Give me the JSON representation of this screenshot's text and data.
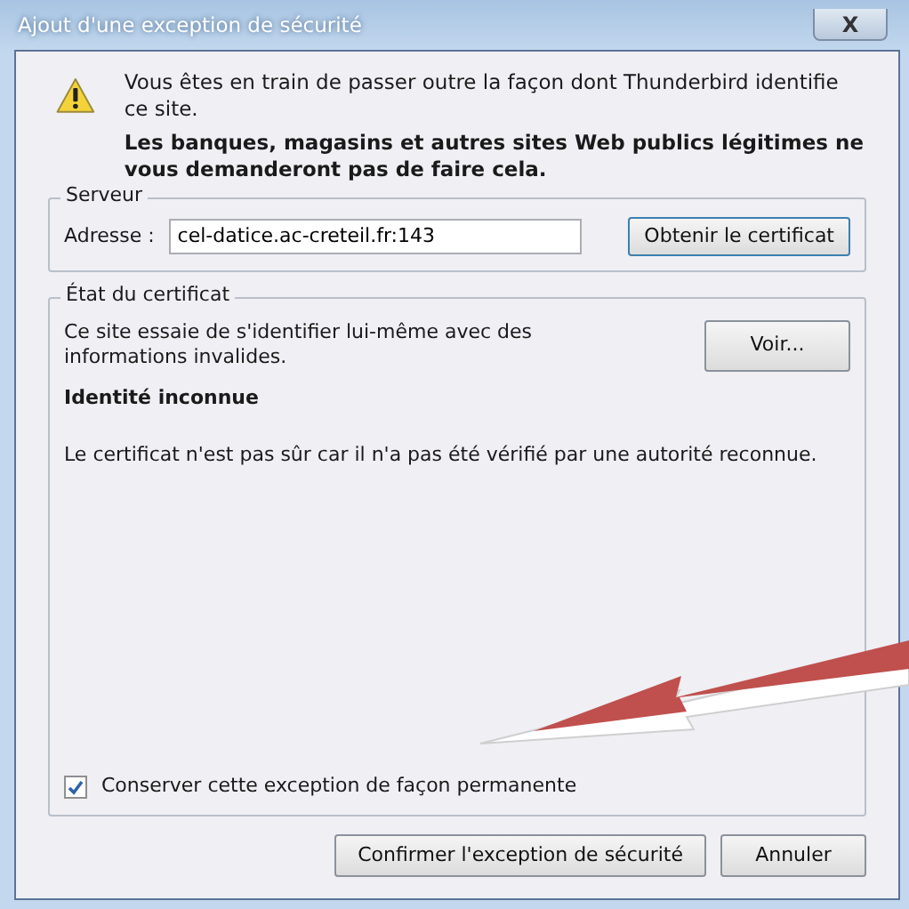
{
  "window": {
    "title": "Ajout d'une exception de sécurité",
    "close_glyph": "X"
  },
  "message": {
    "line": "Vous êtes en train de passer outre la façon dont Thunderbird identifie ce site.",
    "warning": "Les banques, magasins et autres sites Web publics légitimes ne vous demanderont pas de faire cela."
  },
  "server": {
    "legend": "Serveur",
    "address_label": "Adresse :",
    "address_value": "cel-datice.ac-creteil.fr:143",
    "get_button": "Obtenir le certificat"
  },
  "certificate": {
    "legend": "État du certificat",
    "description": "Ce site essaie de s'identifier lui-même avec des informations invalides.",
    "view_button": "Voir...",
    "identity_title": "Identité inconnue",
    "identity_detail": "Le certificat n'est pas sûr car il n'a pas été vérifié par une autorité reconnue."
  },
  "permanent": {
    "label": "Conserver cette exception de façon permanente",
    "checked": true
  },
  "buttons": [
    {
      "label": "Confirmer l'exception de sécurité",
      "kind": "confirm"
    },
    {
      "label": "Annuler",
      "kind": "cancel"
    }
  ]
}
